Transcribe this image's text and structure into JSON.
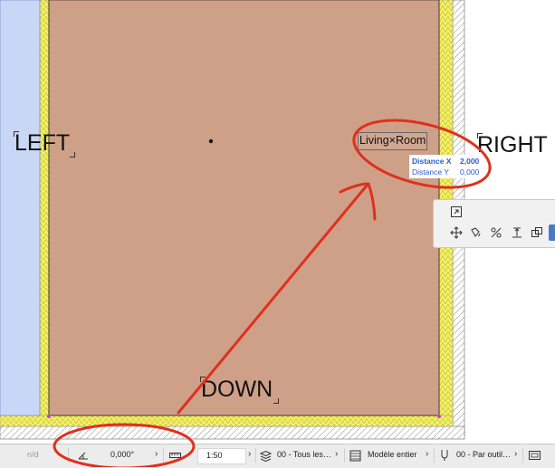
{
  "floor_plan": {
    "labels": {
      "left": "LEFT",
      "right": "RIGHT",
      "down": "DOWN"
    },
    "zone_stamp": "Living×Room",
    "tracker": {
      "distance_x_label": "Distance X",
      "distance_x_value": "2,000",
      "distance_y_label": "Distance Y",
      "distance_y_value": "0,000"
    },
    "colors": {
      "room_fill": "#cfa088",
      "left_zone_fill": "#c9d6f5",
      "insulation": "#f5f16a",
      "annotation_red": "#e0301e"
    }
  },
  "toolbar": {
    "icons": [
      "new-element-icon",
      "move-icon",
      "rotate-icon",
      "offset-icon",
      "elevate-icon",
      "multiply-icon",
      "more-icon"
    ]
  },
  "status_bar": {
    "nd": "n/d",
    "angle": "0,000°",
    "scale": "1:50",
    "layers": "00 - Tous les…",
    "model": "Modèle entier",
    "pen_set": "00 - Par outil…"
  }
}
